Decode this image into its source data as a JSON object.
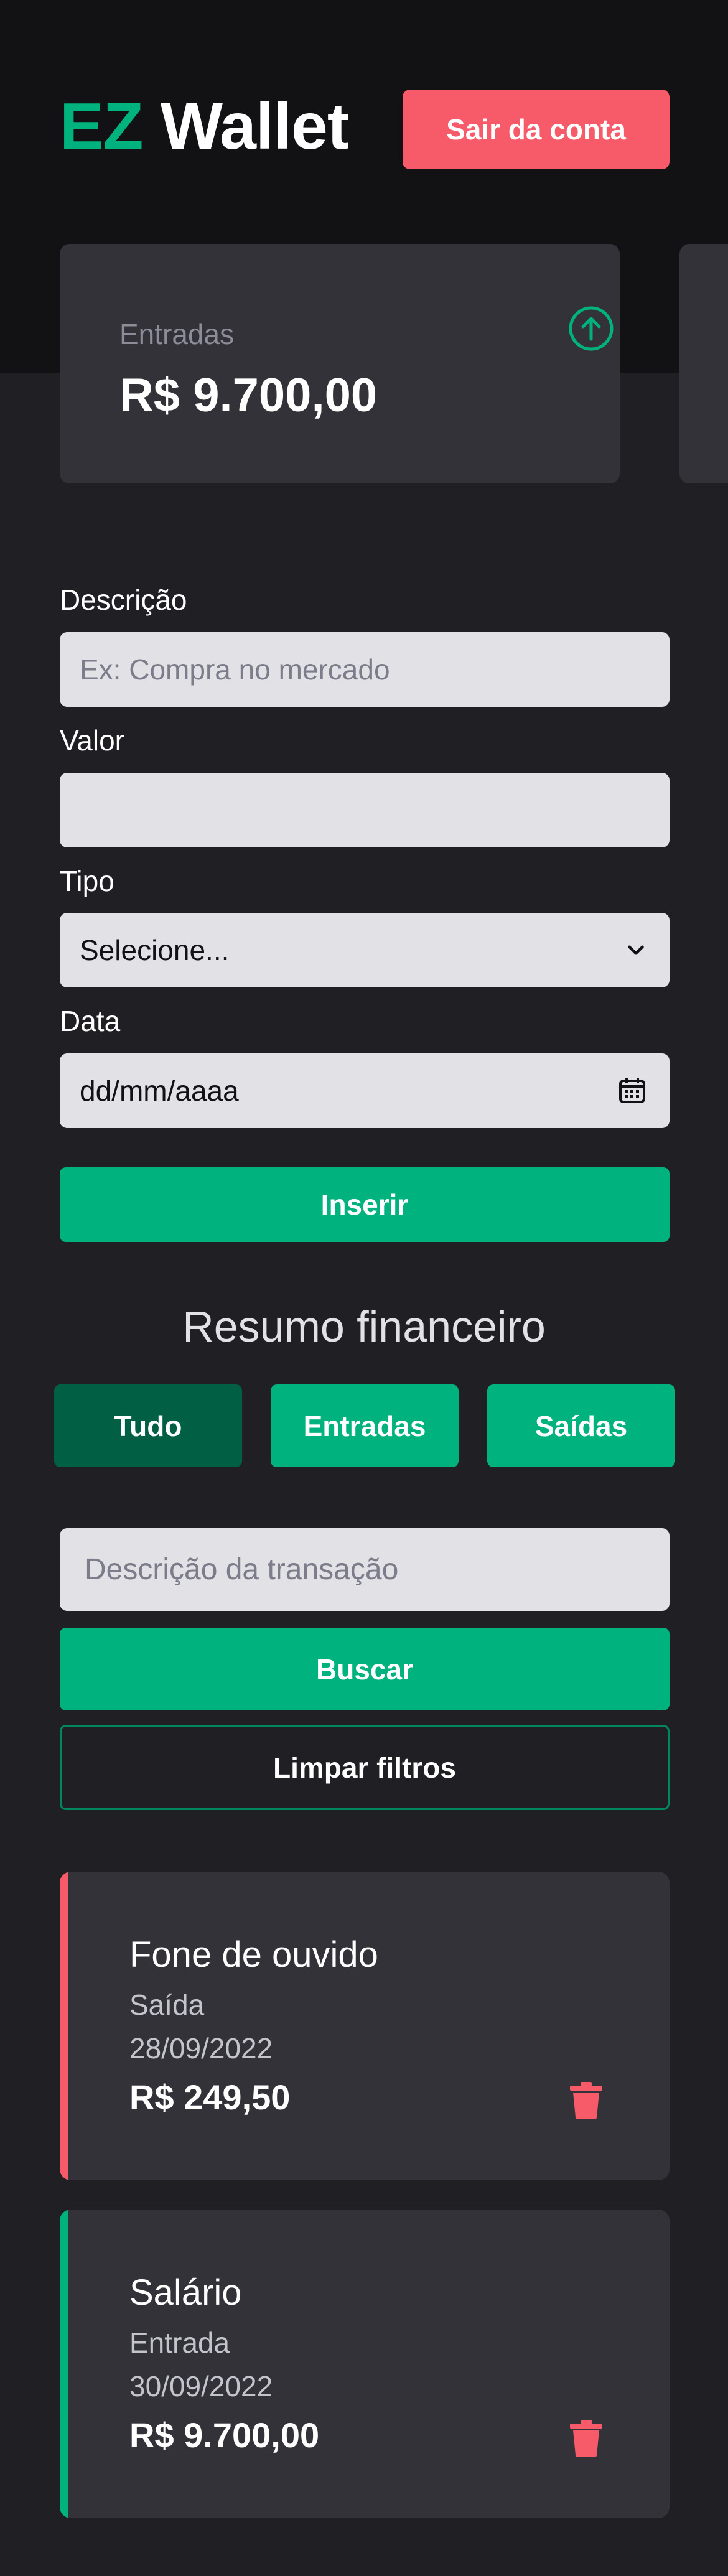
{
  "header": {
    "logo_accent": "EZ",
    "logo_rest": "Wallet",
    "logout_label": "Sair da conta"
  },
  "summary": {
    "income_label": "Entradas",
    "income_value": "R$ 9.700,00",
    "income_icon": "arrow-up-circle-icon"
  },
  "form": {
    "description_label": "Descrição",
    "description_placeholder": "Ex: Compra no mercado",
    "value_label": "Valor",
    "value_placeholder": "",
    "type_label": "Tipo",
    "type_selected": "Selecione...",
    "date_label": "Data",
    "date_placeholder": "dd/mm/aaaa",
    "submit_label": "Inserir"
  },
  "overview": {
    "title": "Resumo financeiro",
    "filters": [
      "Tudo",
      "Entradas",
      "Saídas"
    ],
    "active_filter": "Tudo"
  },
  "search": {
    "placeholder": "Descrição da transação",
    "search_label": "Buscar",
    "clear_label": "Limpar filtros"
  },
  "transactions": [
    {
      "title": "Fone de ouvido",
      "type": "Saída",
      "date": "28/09/2022",
      "amount": "R$ 249,50",
      "kind": "expense"
    },
    {
      "title": "Salário",
      "type": "Entrada",
      "date": "30/09/2022",
      "amount": "R$ 9.700,00",
      "kind": "income"
    }
  ],
  "colors": {
    "brand_green": "#00b37e",
    "dark_green": "#015f43",
    "danger_red": "#f75a68",
    "background": "#202024",
    "header_background": "#121214",
    "card_background": "#323238",
    "input_background": "#e1e1e6"
  }
}
